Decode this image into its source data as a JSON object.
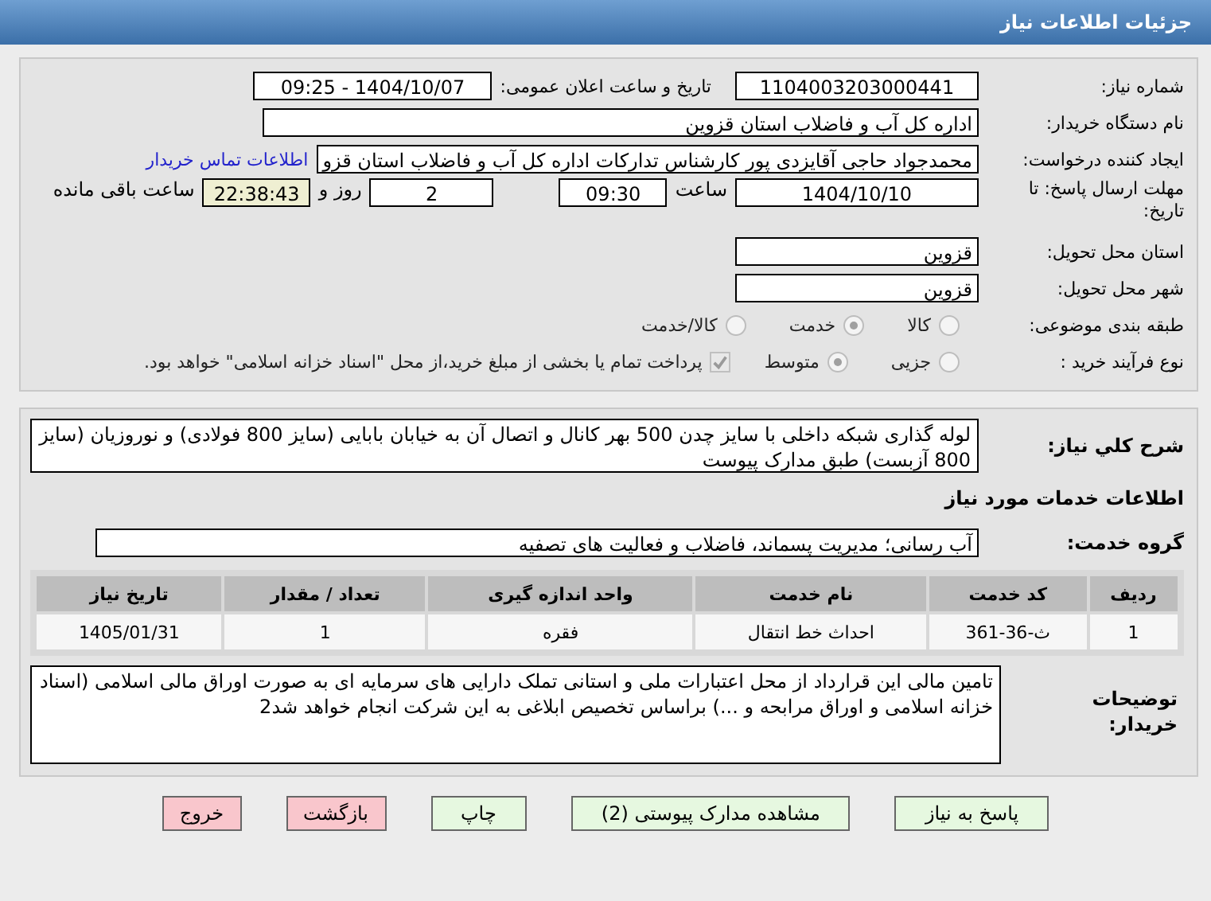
{
  "header": {
    "title": "جزئیات اطلاعات نیاز"
  },
  "need_number": {
    "label": "شماره نیاز:",
    "value": "1104003203000441"
  },
  "announce": {
    "label": "تاریخ و ساعت اعلان عمومی:",
    "value": "1404/10/07 - 09:25"
  },
  "buyer_org": {
    "label": "نام دستگاه خریدار:",
    "value": "اداره کل آب و فاضلاب استان قزوین"
  },
  "requester": {
    "label": "ایجاد کننده درخواست:",
    "value": "محمدجواد حاجی آقایزدی پور کارشناس تدارکات اداره کل آب و فاضلاب استان قزو",
    "link": "اطلاعات تماس خریدار"
  },
  "deadline": {
    "label": "مهلت ارسال پاسخ: تا تاریخ:",
    "date": "1404/10/10",
    "time_label": "ساعت",
    "time": "09:30",
    "days": "2",
    "days_label": "روز و",
    "remaining": "22:38:43",
    "remaining_label": "ساعت باقی مانده"
  },
  "province": {
    "label": "استان محل تحویل:",
    "value": "قزوین"
  },
  "city": {
    "label": "شهر محل تحویل:",
    "value": "قزوین"
  },
  "category": {
    "label": "طبقه بندی موضوعی:",
    "options": [
      {
        "label": "کالا",
        "selected": false
      },
      {
        "label": "خدمت",
        "selected": true
      },
      {
        "label": "کالا/خدمت",
        "selected": false
      }
    ]
  },
  "purchase_type": {
    "label": "نوع فرآیند خرید :",
    "options": [
      {
        "label": "جزیی",
        "selected": false
      },
      {
        "label": "متوسط",
        "selected": true
      }
    ],
    "payment": {
      "checked": true,
      "text": "پرداخت تمام یا بخشی از مبلغ خرید،از محل \"اسناد خزانه اسلامی\" خواهد بود."
    }
  },
  "description": {
    "label": "شرح كلي نياز:",
    "value": "لوله گذاری شبکه داخلی  با سایز چدن 500 بهر کانال و اتصال آن به خیابان بابایی (سایز 800  فولادی) و نوروزیان (سایز 800 آزبست) طبق مدارک پیوست"
  },
  "services_title": "اطلاعات خدمات مورد نیاز",
  "service_group": {
    "label": "گروه خدمت:",
    "value": "آب رسانی؛ مدیریت پسماند، فاضلاب و فعالیت های تصفیه"
  },
  "table": {
    "columns": [
      "ردیف",
      "کد خدمت",
      "نام خدمت",
      "واحد اندازه گیری",
      "تعداد / مقدار",
      "تاریخ نیاز"
    ],
    "rows": [
      [
        "1",
        "ث-36-361",
        "احداث خط انتقال",
        "فقره",
        "1",
        "1405/01/31"
      ]
    ]
  },
  "buyer_notes": {
    "label": "توضیحات خریدار:",
    "value": "تامین مالی این قرارداد از محل اعتبارات ملی و استانی تملک دارایی های سرمایه ای به صورت اوراق مالی اسلامی (اسناد خزانه اسلامی و اوراق مرابحه و ...) براساس تخصیص ابلاغی به این شرکت انجام خواهد شد2"
  },
  "buttons": [
    {
      "label": "پاسخ به نیاز",
      "kind": "normal"
    },
    {
      "label": "مشاهده مدارک پیوستی (2)",
      "kind": "normal"
    },
    {
      "label": "چاپ",
      "kind": "normal"
    },
    {
      "label": "بازگشت",
      "kind": "danger"
    },
    {
      "label": "خروج",
      "kind": "danger"
    }
  ]
}
